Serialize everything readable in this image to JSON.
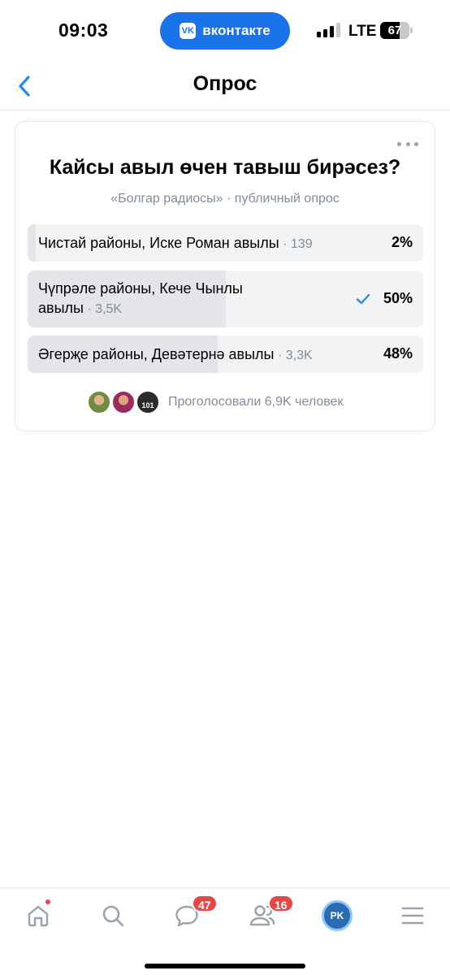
{
  "status_bar": {
    "time": "09:03",
    "app_pill_label": "вконтакте",
    "app_pill_logo": "vk",
    "network": "LTE",
    "battery_percent": "67",
    "battery_level": 0.67,
    "signal_bars_active": 3
  },
  "header": {
    "title": "Опрос",
    "back_icon": "chevron-left-icon"
  },
  "poll": {
    "question": "Кайсы авыл өчен тавыш бирәсез?",
    "subtitle": "«Болгар радиосы» · публичный опрос",
    "options": [
      {
        "line1": "Чистай районы, Иске Роман авылы",
        "line2": "",
        "count": " · 139",
        "percent": "2%",
        "share": 0.02,
        "selected": false
      },
      {
        "line1": "Чүпрәле районы, Кече Чынлы",
        "line2": "авылы",
        "count": " · 3,5K",
        "percent": "50%",
        "share": 0.5,
        "selected": true
      },
      {
        "line1": "Әгерҗе районы, Девәтернә авылы",
        "line2": "",
        "count": " · 3,3K",
        "percent": "48%",
        "share": 0.48,
        "selected": false
      }
    ],
    "voters_text": "Проголосовали 6,9K человек",
    "voter_avatar_3_label": "101"
  },
  "tab_bar": {
    "messages_badge": "47",
    "friends_badge": "16",
    "profile_initials": "PK"
  },
  "colors": {
    "accent": "#1a73e8",
    "check": "#2688eb",
    "badge": "#e64646",
    "secondary_text": "#818c99"
  }
}
